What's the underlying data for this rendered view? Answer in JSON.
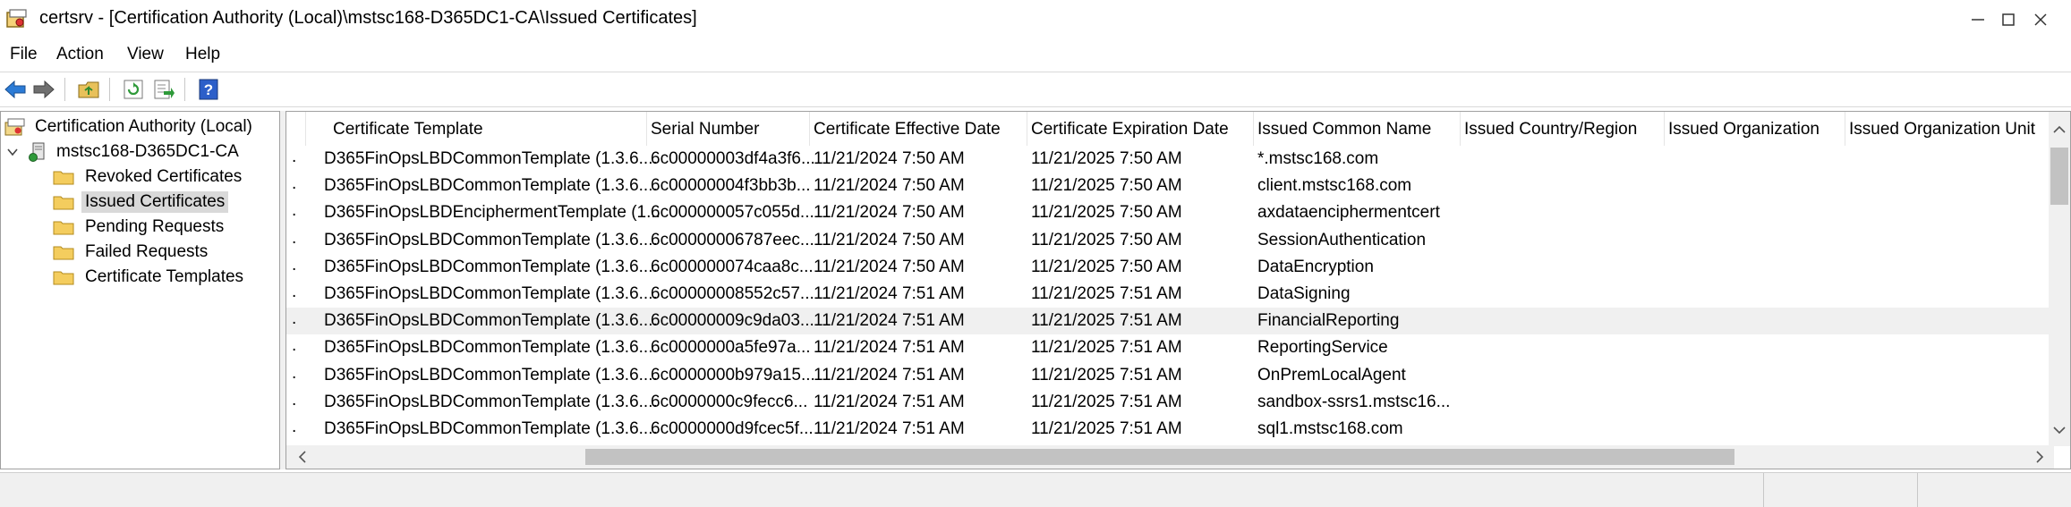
{
  "window": {
    "title": "certsrv - [Certification Authority (Local)\\mstsc168-D365DC1-CA\\Issued Certificates]",
    "icon": "certsrv-app-icon"
  },
  "menu": {
    "items": [
      "File",
      "Action",
      "View",
      "Help"
    ]
  },
  "toolbar": {
    "icons": [
      "back-arrow-icon",
      "forward-arrow-icon",
      "up-folder-icon",
      "refresh-icon",
      "export-list-icon",
      "help-icon"
    ]
  },
  "tree": {
    "root": "Certification Authority (Local)",
    "ca": "mstsc168-D365DC1-CA",
    "children": [
      "Revoked Certificates",
      "Issued Certificates",
      "Pending Requests",
      "Failed Requests",
      "Certificate Templates"
    ],
    "selected": "Issued Certificates"
  },
  "table": {
    "columns": [
      "Certificate Template",
      "Serial Number",
      "Certificate Effective Date",
      "Certificate Expiration Date",
      "Issued Common Name",
      "Issued Country/Region",
      "Issued Organization",
      "Issued Organization Unit"
    ],
    "rows": [
      {
        "template": "D365FinOpsLBDCommonTemplate (1.3.6....",
        "serial": "6c00000003df4a3f6...",
        "effective": "11/21/2024 7:50 AM",
        "expiration": "11/21/2025 7:50 AM",
        "cn": "*.mstsc168.com"
      },
      {
        "template": "D365FinOpsLBDCommonTemplate (1.3.6....",
        "serial": "6c00000004f3bb3b...",
        "effective": "11/21/2024 7:50 AM",
        "expiration": "11/21/2025 7:50 AM",
        "cn": "client.mstsc168.com"
      },
      {
        "template": "D365FinOpsLBDEnciphermentTemplate (1...",
        "serial": "6c000000057c055d...",
        "effective": "11/21/2024 7:50 AM",
        "expiration": "11/21/2025 7:50 AM",
        "cn": "axdataenciphermentcert"
      },
      {
        "template": "D365FinOpsLBDCommonTemplate (1.3.6....",
        "serial": "6c00000006787eec...",
        "effective": "11/21/2024 7:50 AM",
        "expiration": "11/21/2025 7:50 AM",
        "cn": "SessionAuthentication"
      },
      {
        "template": "D365FinOpsLBDCommonTemplate (1.3.6....",
        "serial": "6c000000074caa8c...",
        "effective": "11/21/2024 7:50 AM",
        "expiration": "11/21/2025 7:50 AM",
        "cn": "DataEncryption"
      },
      {
        "template": "D365FinOpsLBDCommonTemplate (1.3.6....",
        "serial": "6c00000008552c57...",
        "effective": "11/21/2024 7:51 AM",
        "expiration": "11/21/2025 7:51 AM",
        "cn": "DataSigning"
      },
      {
        "template": "D365FinOpsLBDCommonTemplate (1.3.6....",
        "serial": "6c00000009c9da03...",
        "effective": "11/21/2024 7:51 AM",
        "expiration": "11/21/2025 7:51 AM",
        "cn": "FinancialReporting"
      },
      {
        "template": "D365FinOpsLBDCommonTemplate (1.3.6....",
        "serial": "6c0000000a5fe97a...",
        "effective": "11/21/2024 7:51 AM",
        "expiration": "11/21/2025 7:51 AM",
        "cn": "ReportingService"
      },
      {
        "template": "D365FinOpsLBDCommonTemplate (1.3.6....",
        "serial": "6c0000000b979a15...",
        "effective": "11/21/2024 7:51 AM",
        "expiration": "11/21/2025 7:51 AM",
        "cn": "OnPremLocalAgent"
      },
      {
        "template": "D365FinOpsLBDCommonTemplate (1.3.6....",
        "serial": "6c0000000c9fecc6...",
        "effective": "11/21/2024 7:51 AM",
        "expiration": "11/21/2025 7:51 AM",
        "cn": "sandbox-ssrs1.mstsc16..."
      },
      {
        "template": "D365FinOpsLBDCommonTemplate (1.3.6....",
        "serial": "6c0000000d9fcec5f...",
        "effective": "11/21/2024 7:51 AM",
        "expiration": "11/21/2025 7:51 AM",
        "cn": "sql1.mstsc168.com"
      }
    ],
    "row_marker": ".",
    "highlighted_row": 6
  },
  "colors": {
    "selection": "#d9d9d9",
    "hover_row": "#f0f0f0",
    "accent": "#1e6fd9"
  }
}
